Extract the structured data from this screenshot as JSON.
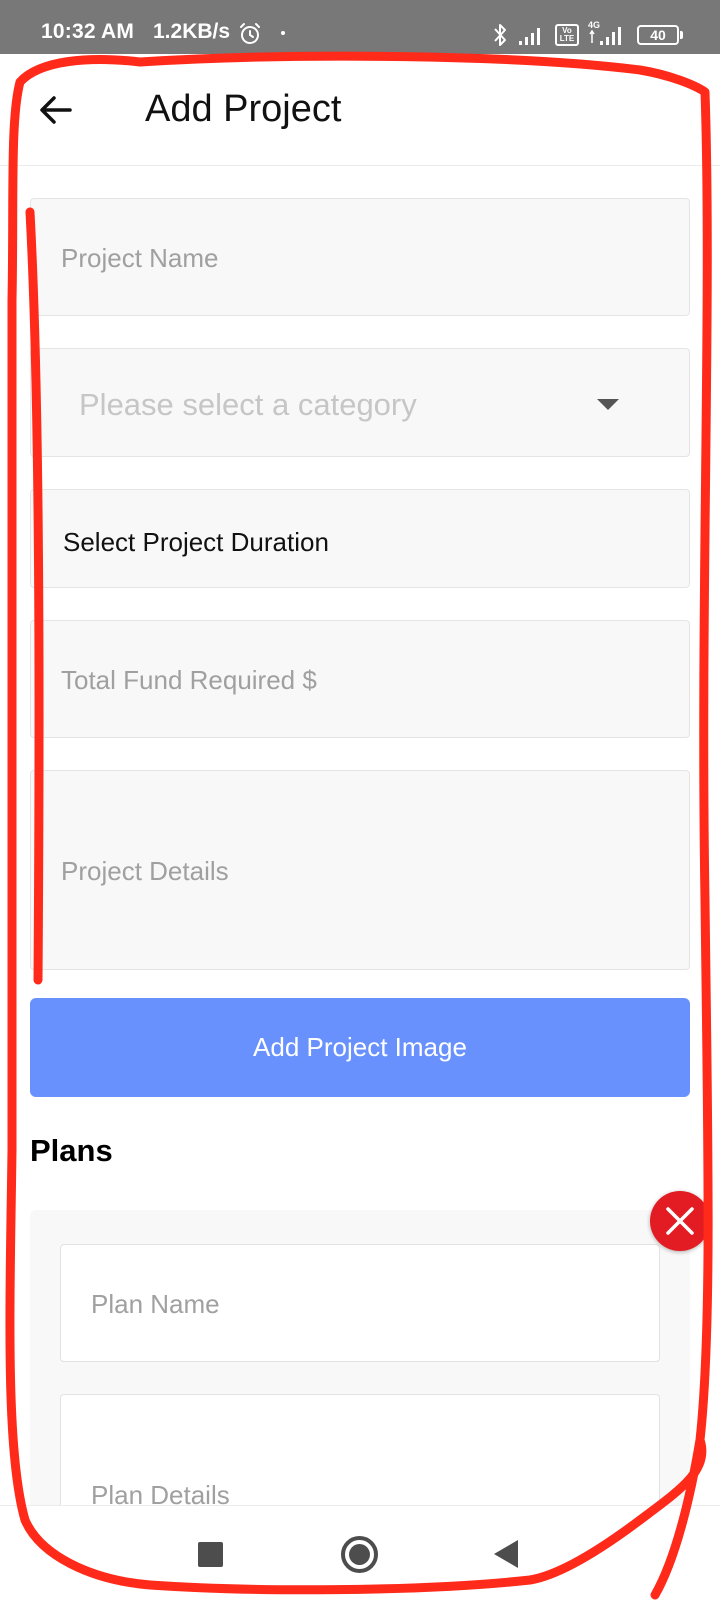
{
  "status_bar": {
    "time": "10:32 AM",
    "net_speed": "1.2KB/s",
    "volte": "Vo LTE",
    "network_type": "4G",
    "battery": "40"
  },
  "header": {
    "title": "Add Project"
  },
  "form": {
    "project_name_placeholder": "Project Name",
    "category_placeholder": "Please select a category",
    "duration_label": "Select Project Duration",
    "total_fund_placeholder": "Total Fund Required $",
    "project_details_placeholder": "Project Details",
    "add_image_label": "Add Project Image"
  },
  "plans": {
    "heading": "Plans",
    "plan_name_placeholder": "Plan Name",
    "plan_details_placeholder": "Plan Details"
  },
  "colors": {
    "primary_button": "#6891fd",
    "remove_button": "#e31c23",
    "annotation": "#ff2a1a",
    "status_bar": "#787878"
  }
}
